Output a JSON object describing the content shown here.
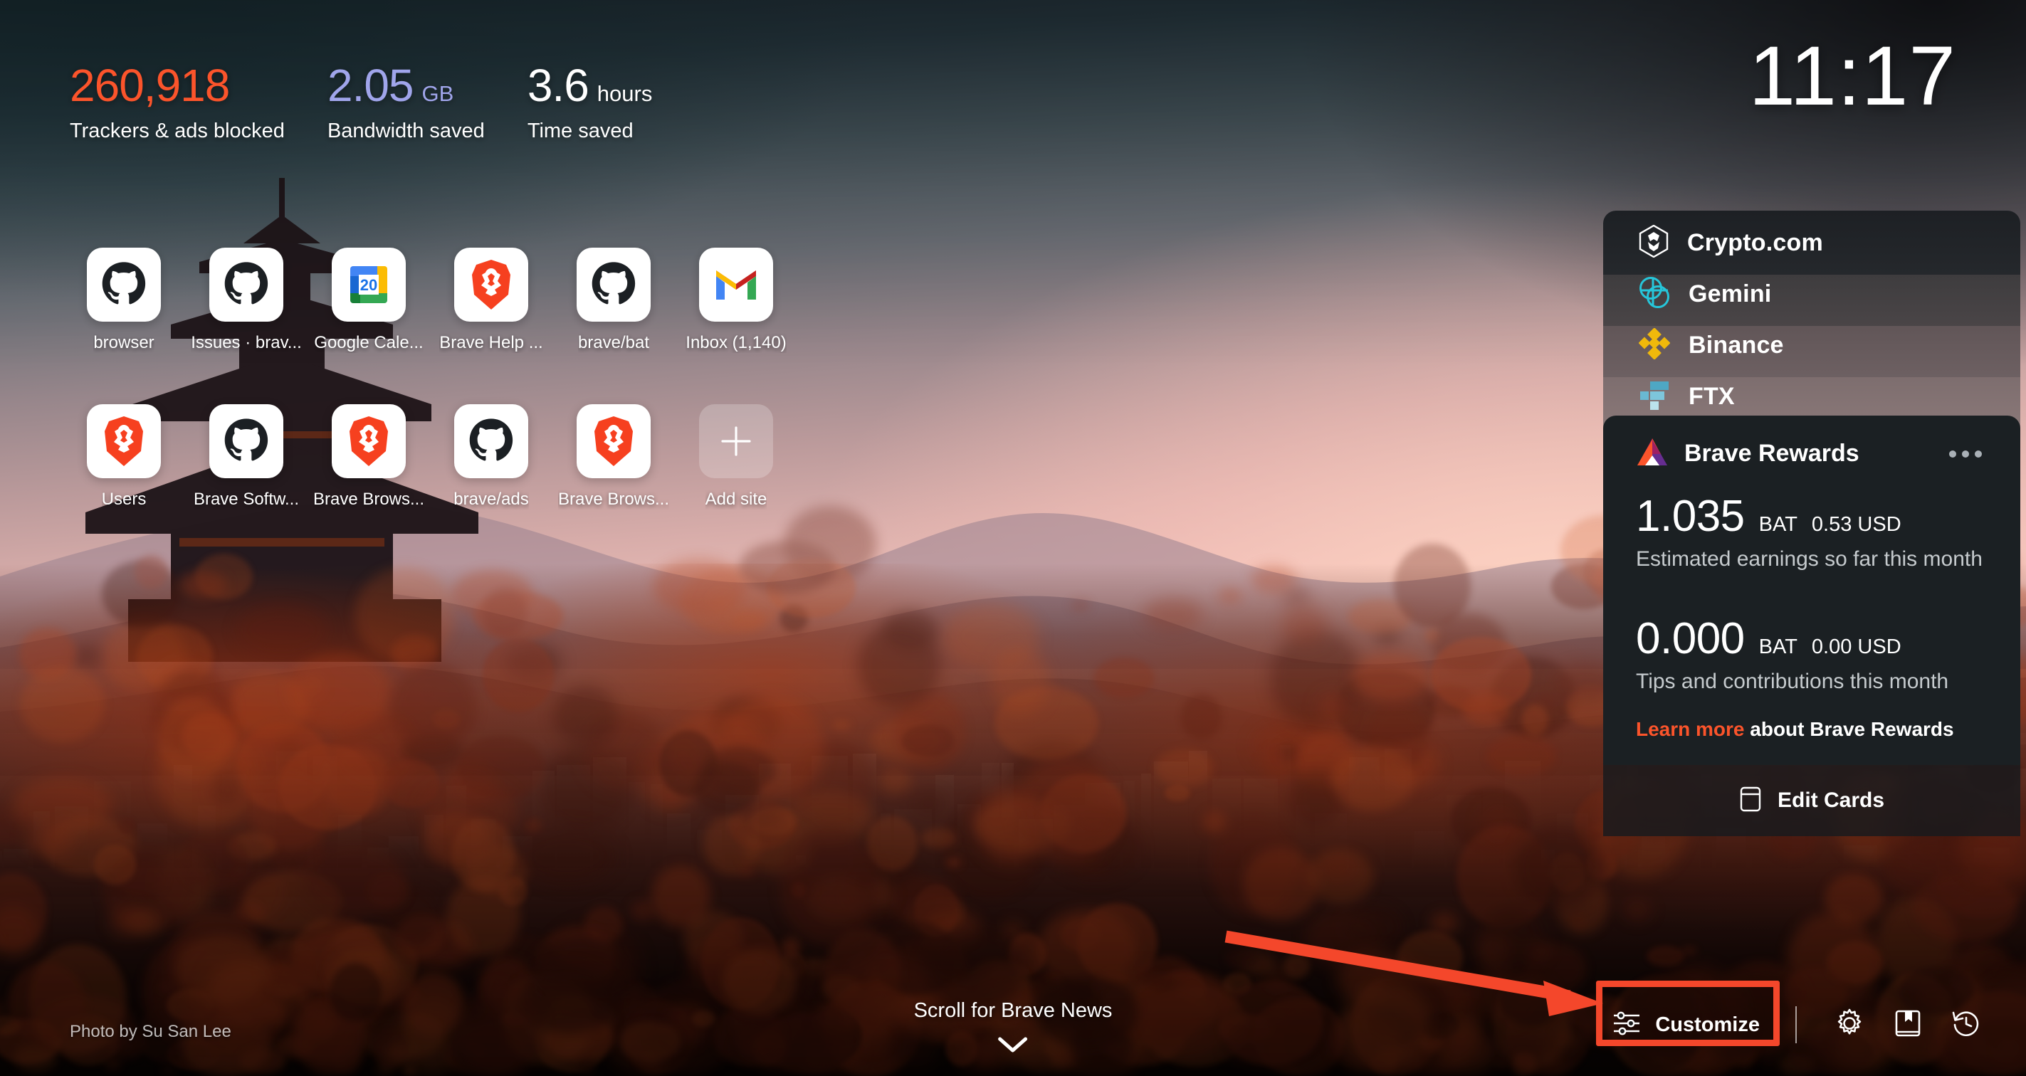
{
  "clock": {
    "time": "11:17"
  },
  "stats": [
    {
      "value": "260,918",
      "unit": "",
      "label": "Trackers & ads blocked",
      "color": "#FB542B"
    },
    {
      "value": "2.05",
      "unit": "GB",
      "label": "Bandwidth saved",
      "color": "#A0A5EB"
    },
    {
      "value": "3.6",
      "unit": "hours",
      "label": "Time saved",
      "color": "#FFFFFF"
    }
  ],
  "top_sites": [
    {
      "label": "browser",
      "icon": "github-icon"
    },
    {
      "label": "Issues · brav...",
      "icon": "github-icon"
    },
    {
      "label": "Google Cale...",
      "icon": "google-calendar-icon"
    },
    {
      "label": "Brave Help ...",
      "icon": "brave-lion-icon"
    },
    {
      "label": "brave/bat",
      "icon": "github-icon"
    },
    {
      "label": "Inbox (1,140)",
      "icon": "gmail-icon"
    },
    {
      "label": "Users",
      "icon": "brave-lion-icon"
    },
    {
      "label": "Brave Softw...",
      "icon": "github-icon"
    },
    {
      "label": "Brave Brows...",
      "icon": "brave-lion-icon"
    },
    {
      "label": "brave/ads",
      "icon": "github-icon"
    },
    {
      "label": "Brave Brows...",
      "icon": "brave-lion-icon"
    },
    {
      "label": "Add site",
      "icon": "plus-icon"
    }
  ],
  "crypto_widgets": [
    {
      "label": "Crypto.com",
      "icon": "cryptocom-icon"
    },
    {
      "label": "Gemini",
      "icon": "gemini-icon"
    },
    {
      "label": "Binance",
      "icon": "binance-icon"
    },
    {
      "label": "FTX",
      "icon": "ftx-icon"
    }
  ],
  "rewards": {
    "title": "Brave Rewards",
    "earnings": {
      "amount": "1.035",
      "token": "BAT",
      "fiat": "0.53 USD",
      "caption": "Estimated earnings so far this month"
    },
    "tips": {
      "amount": "0.000",
      "token": "BAT",
      "fiat": "0.00 USD",
      "caption": "Tips and contributions this month"
    },
    "learn_more_link": "Learn more",
    "learn_more_rest": " about Brave Rewards",
    "more_menu": "more-options"
  },
  "edit_cards": {
    "label": "Edit Cards"
  },
  "footer": {
    "photo_credit": "Photo by Su San Lee",
    "scroll_label": "Scroll for Brave News",
    "customize_label": "Customize"
  },
  "bottom_icons": [
    {
      "name": "settings-gear-icon"
    },
    {
      "name": "bookmarks-icon"
    },
    {
      "name": "history-icon"
    }
  ],
  "annotation": {
    "highlight_color": "#F4472B"
  }
}
